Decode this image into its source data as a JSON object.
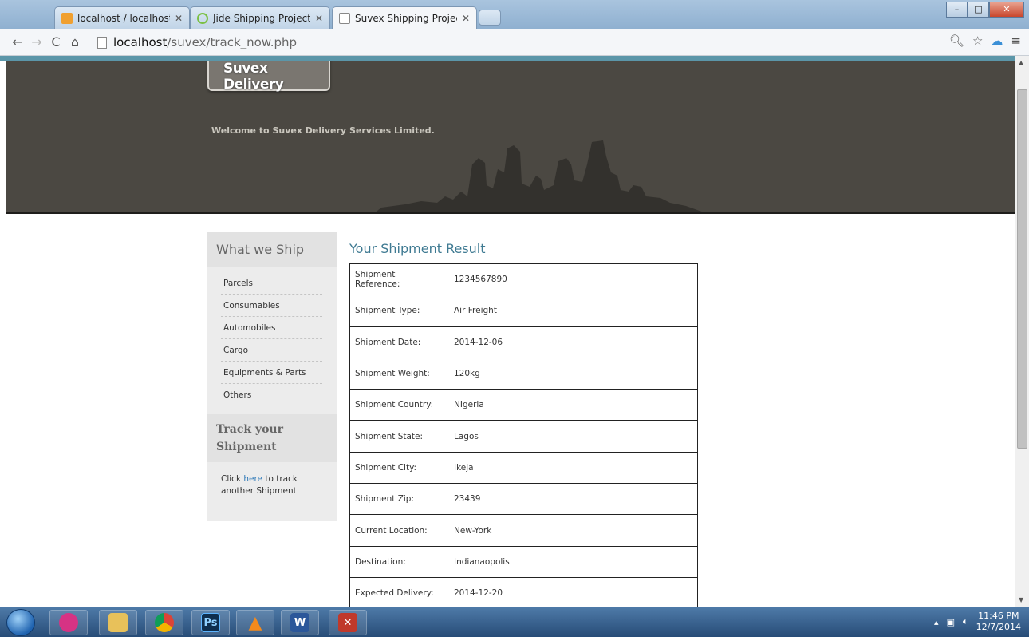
{
  "browser": {
    "tabs": [
      {
        "label": "localhost / localhost / ord",
        "active": false,
        "icon": "phpmyadmin-icon"
      },
      {
        "label": "Jide Shipping Project",
        "active": false,
        "icon": "loading-spinner-icon"
      },
      {
        "label": "Suvex Shipping Project",
        "active": true,
        "icon": "page-icon"
      }
    ],
    "url_host": "localhost",
    "url_path": "/suvex/track_now.php"
  },
  "site": {
    "logo": "Suvex Delivery",
    "welcome": "Welcome to Suvex Delivery Services Limited."
  },
  "sidebar": {
    "section1_title": "What we Ship",
    "items": [
      "Parcels",
      "Consumables",
      "Automobiles",
      "Cargo",
      "Equipments & Parts",
      "Others"
    ],
    "section2_title": "Track your Shipment",
    "track_prefix": "Click ",
    "track_link": "here",
    "track_suffix": " to track another Shipment"
  },
  "result": {
    "title": "Your Shipment Result",
    "rows": [
      {
        "label": "Shipment Reference:",
        "value": "1234567890"
      },
      {
        "label": "Shipment Type:",
        "value": "Air Freight"
      },
      {
        "label": "Shipment Date:",
        "value": "2014-12-06"
      },
      {
        "label": "Shipment Weight:",
        "value": "120kg"
      },
      {
        "label": "Shipment Country:",
        "value": "NIgeria"
      },
      {
        "label": "Shipment State:",
        "value": "Lagos"
      },
      {
        "label": "Shipment City:",
        "value": "Ikeja"
      },
      {
        "label": "Shipment Zip:",
        "value": "23439"
      },
      {
        "label": "Current Location:",
        "value": "New-York"
      },
      {
        "label": "Destination:",
        "value": "Indianaopolis"
      },
      {
        "label": "Expected Delivery:",
        "value": "2014-12-20"
      }
    ]
  },
  "taskbar": {
    "time": "11:46 PM",
    "date": "12/7/2014",
    "apps": [
      "Ps",
      "W"
    ]
  },
  "colors": {
    "banner": "#4b4842",
    "accent": "#5b96a9",
    "link": "#2d78b7"
  }
}
